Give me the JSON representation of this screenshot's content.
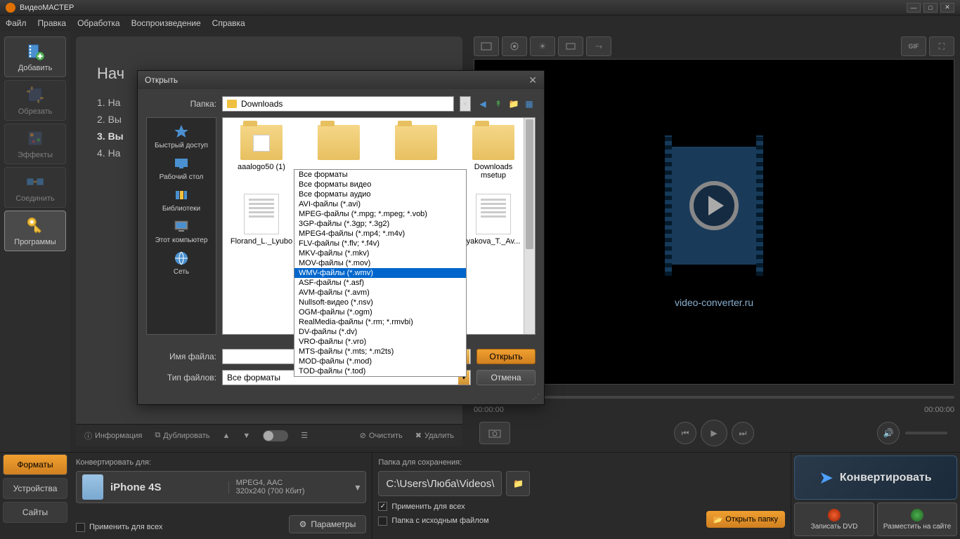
{
  "app": {
    "title": "ВидеоМАСТЕР"
  },
  "menu": [
    "Файл",
    "Правка",
    "Обработка",
    "Воспроизведение",
    "Справка"
  ],
  "tools": {
    "add": "Добавить",
    "crop": "Обрезать",
    "effects": "Эффекты",
    "join": "Соединить",
    "programs": "Программы"
  },
  "start": {
    "title": "Нач",
    "steps": [
      "1. На",
      "2. Вы",
      "3. Вы",
      "4. На"
    ]
  },
  "preview": {
    "url": "video-converter.ru",
    "t0": "00:00:00",
    "t1": "00:00:00",
    "gif_label": "GIF"
  },
  "bottom": {
    "info": "Информация",
    "dup": "Дублировать",
    "clear": "Очистить",
    "delete": "Удалить"
  },
  "footer": {
    "tabs": {
      "formats": "Форматы",
      "devices": "Устройства",
      "sites": "Сайты"
    },
    "convert_for": "Конвертировать для:",
    "device": {
      "name": "iPhone 4S",
      "codec": "MPEG4, AAC",
      "spec": "320x240 (700 Кбит)"
    },
    "apply_all": "Применить для всех",
    "params": "Параметры",
    "save_folder_label": "Папка для сохранения:",
    "save_path": "C:\\Users\\Люба\\Videos\\",
    "apply_all2": "Применить для всех",
    "keep_source": "Папка с исходным файлом",
    "open_folder": "Открыть папку",
    "convert": "Конвертировать",
    "burn_dvd": "Записать DVD",
    "publish": "Разместить на сайте"
  },
  "dialog": {
    "title": "Открыть",
    "folder_label": "Папка:",
    "folder": "Downloads",
    "places": [
      "Быстрый доступ",
      "Рабочий стол",
      "Библиотеки",
      "Этот компьютер",
      "Сеть"
    ],
    "files": [
      {
        "name": "aaalogo50 (1)",
        "type": "folder-img"
      },
      {
        "name": "",
        "type": "folder"
      },
      {
        "name": "",
        "type": "folder"
      },
      {
        "name": "Downloads msetup",
        "type": "folder"
      },
      {
        "name": "Florand_L._Lyubo",
        "type": "doc"
      },
      {
        "name": "",
        "type": "doc"
      },
      {
        "name": "",
        "type": "doc"
      },
      {
        "name": "yakova_T._Av...",
        "type": "doc"
      }
    ],
    "filename_label": "Имя файла:",
    "filetype_label": "Тип файлов:",
    "filetype_value": "Все форматы",
    "open_btn": "Открыть",
    "cancel_btn": "Отмена",
    "filetypes": [
      "Все форматы",
      "Все форматы видео",
      "Все форматы аудио",
      "AVI-файлы (*.avi)",
      "MPEG-файлы (*.mpg; *.mpeg; *.vob)",
      "3GP-файлы (*.3gp; *.3g2)",
      "MPEG4-файлы (*.mp4; *.m4v)",
      "FLV-файлы (*.flv; *.f4v)",
      "MKV-файлы (*.mkv)",
      "MOV-файлы (*.mov)",
      "WMV-файлы (*.wmv)",
      "ASF-файлы (*.asf)",
      "AVM-файлы (*.avm)",
      "Nullsoft-видео (*.nsv)",
      "OGM-файлы (*.ogm)",
      "RealMedia-файлы (*.rm; *.rmvbi)",
      "DV-файлы (*.dv)",
      "VRO-файлы (*.vro)",
      "MTS-файлы (*.mts; *.m2ts)",
      "MOD-файлы (*.mod)",
      "TOD-файлы (*.tod)"
    ],
    "filetype_selected_index": 10
  }
}
